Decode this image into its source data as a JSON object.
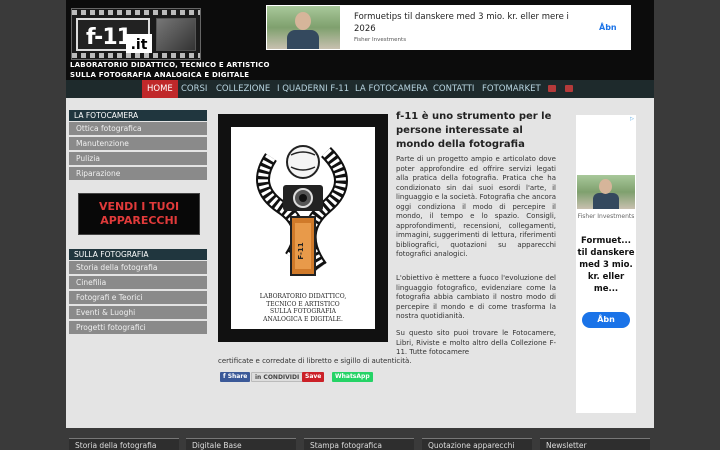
{
  "header": {
    "logo_text": "f-11",
    "logo_suffix": ".it",
    "tagline_1": "LABORATORIO DIDATTICO, TECNICO E ARTISTICO",
    "tagline_2": "SULLA FOTOGRAFIA ANALOGICA E DIGITALE"
  },
  "top_ad": {
    "title": "Formuetips til danskere med 3 mio. kr. eller mere i 2026",
    "source": "Fisher Investments",
    "cta": "Åbn"
  },
  "nav": {
    "items": [
      "HOME",
      "CORSI",
      "COLLEZIONE",
      "I QUADERNI F-11",
      "LA FOTOCAMERA",
      "CONTATTI",
      "FOTOMARKET"
    ]
  },
  "sidebar": {
    "section1_title": "LA FOTOCAMERA",
    "section1_items": [
      "Ottica fotografica",
      "Manutenzione",
      "Pulizia",
      "Riparazione"
    ],
    "banner_line1": "VENDI I TUOI",
    "banner_line2": "APPARECCHI",
    "section2_title": "SULLA FOTOGRAFIA",
    "section2_items": [
      "Storia della fotografia",
      "Cinefilia",
      "Fotografi e Teorici",
      "Eventi & Luoghi",
      "Progetti fotografici"
    ]
  },
  "poster": {
    "line1": "LABORATORIO DIDATTICO,",
    "line2": "TECNICO E ARTISTICO",
    "line3": "SULLA FOTOGRAFIA",
    "line4": "ANALOGICA E DIGITALE."
  },
  "main": {
    "title": "f-11 è uno strumento per le persone interessate al mondo della fotografia",
    "para1": "Parte di un progetto ampio e articolato dove poter approfondire ed offrire servizi legati alla pratica della fotografia. Pratica che ha condizionato sin dai suoi esordi l'arte, il linguaggio e la società. Fotografia che ancora oggi condiziona il modo di percepire il mondo, il tempo e lo spazio. Consigli, approfondimenti, recensioni, collegamenti, immagini, suggerimenti di lettura, riferimenti bibliografici, quotazioni su apparecchi fotografici analogici.",
    "para2": "L'obiettivo è mettere a fuoco l'evoluzione del linguaggio fotografico, evidenziare come la fotografia abbia cambiato il nostro modo di percepire il mondo e di come trasforma la nostra quotidianità.",
    "para3": "Su questo sito puoi trovare le Fotocamere, Libri, Riviste e molto altro della Collezione F-11. Tutte fotocamere",
    "para3b": "certificate e corredate di libretto e sigillo di autenticità."
  },
  "share": {
    "facebook": "f Share",
    "linkedin": "in CONDIVIDI",
    "pinterest": "Save",
    "whatsapp": "WhatsApp"
  },
  "side_ad": {
    "source": "Fisher Investments",
    "title": "Formuet... til danskere med 3 mio. kr. eller me...",
    "cta": "Åbn"
  },
  "footer": {
    "items": [
      "Storia della fotografia",
      "Digitale Base",
      "Stampa fotografica",
      "Quotazione apparecchi",
      "Newsletter"
    ]
  }
}
